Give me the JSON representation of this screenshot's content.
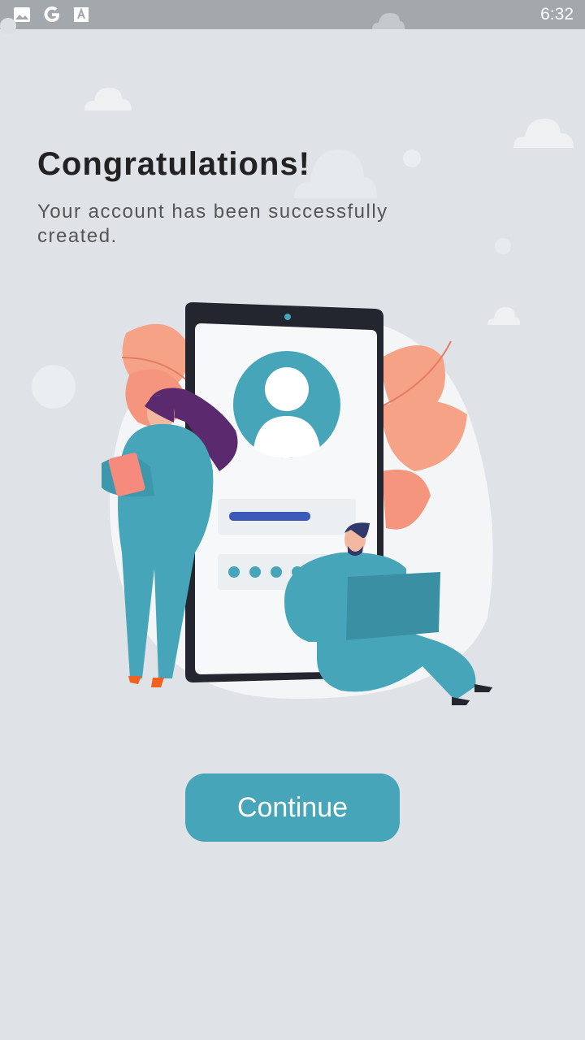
{
  "status_bar": {
    "time": "6:32",
    "icons": [
      "image-icon",
      "google-icon",
      "font-a-icon"
    ]
  },
  "content": {
    "title": "Congratulations!",
    "subtitle": "Your account has been successfully created."
  },
  "actions": {
    "continue_label": "Continue"
  },
  "colors": {
    "background": "#dfe3e8",
    "accent": "#47a5b9",
    "status_bar": "#a3a8ad"
  }
}
